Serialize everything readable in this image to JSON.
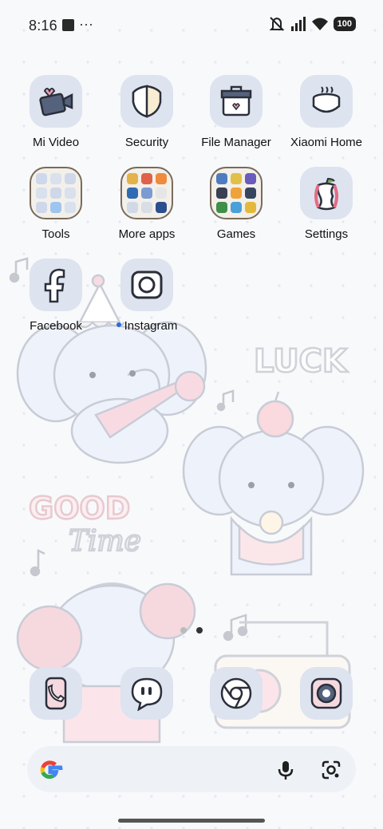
{
  "status_bar": {
    "time": "8:16",
    "more": "···",
    "battery": "100"
  },
  "apps": {
    "row1": [
      {
        "label": "Mi Video"
      },
      {
        "label": "Security"
      },
      {
        "label": "File Manager"
      },
      {
        "label": "Xiaomi Home"
      }
    ],
    "row2": [
      {
        "label": "Tools"
      },
      {
        "label": "More apps"
      },
      {
        "label": "Games"
      },
      {
        "label": "Settings"
      }
    ],
    "row3": [
      {
        "label": "Facebook"
      },
      {
        "label": "Instagram"
      }
    ]
  },
  "wallpaper": {
    "text_luck": "LUCK",
    "text_good": "GOOD",
    "text_time": "Time"
  },
  "page_indicator": {
    "pages": 2,
    "current": 2
  },
  "dock": [
    {
      "icon": "phone-icon"
    },
    {
      "icon": "messaging-icon"
    },
    {
      "icon": "chrome-icon"
    },
    {
      "icon": "camera-icon"
    }
  ],
  "colors": {
    "icon_tile": "#dde3ef",
    "accent_pink": "#f6d9df",
    "accent_blue": "#2f6ad6"
  }
}
